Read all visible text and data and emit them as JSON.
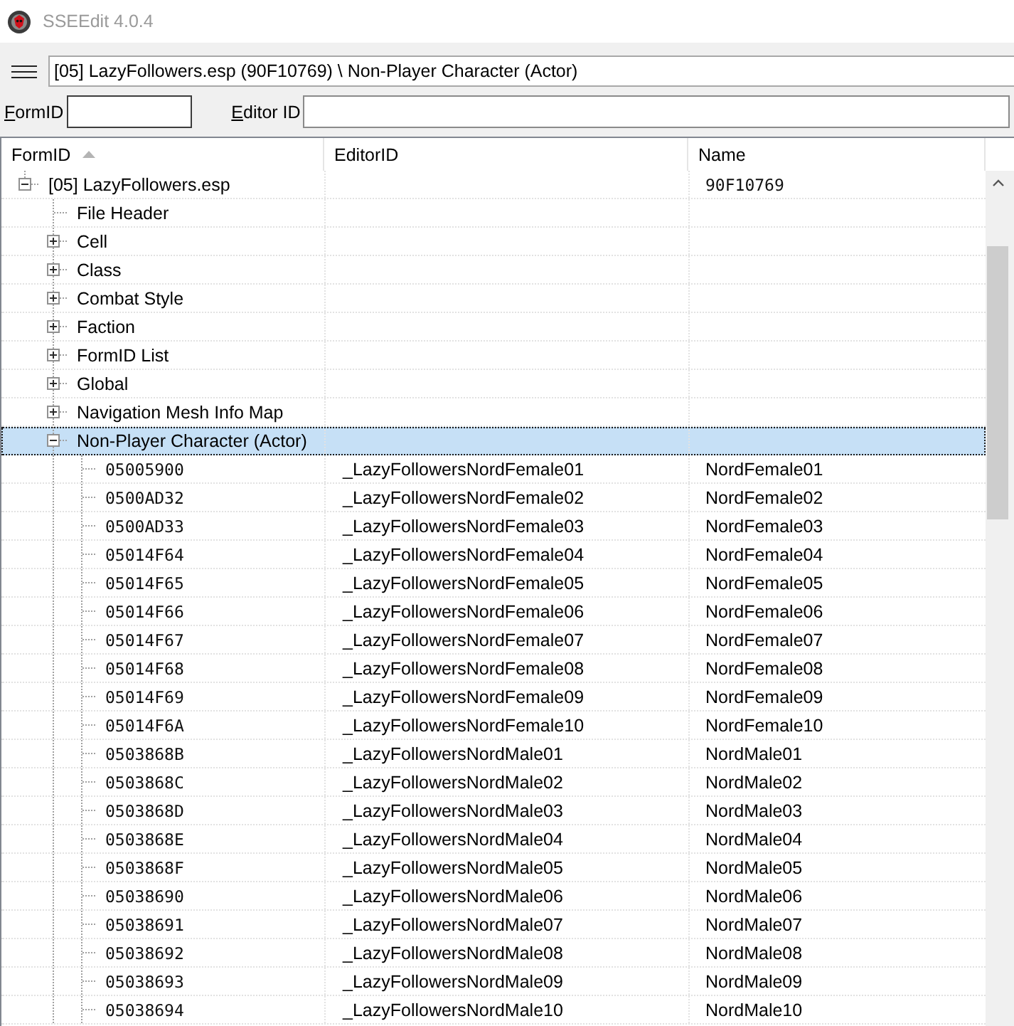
{
  "window": {
    "title": "SSEEdit 4.0.4"
  },
  "path_field": {
    "value": "[05] LazyFollowers.esp (90F10769) \\ Non-Player Character (Actor)"
  },
  "filters": {
    "form_id": {
      "label": "FormID"
    },
    "editor_id": {
      "label": "Editor ID"
    }
  },
  "tree": {
    "columns": [
      {
        "label": "FormID",
        "sorted_ascending": true
      },
      {
        "label": "EditorID",
        "sorted_ascending": false
      },
      {
        "label": "Name",
        "sorted_ascending": false
      }
    ],
    "nodes": [
      {
        "kind": "file",
        "label": "[05] LazyFollowers.esp",
        "name": "90F10769",
        "expanded": true,
        "selected": false,
        "children": [
          {
            "kind": "leaf",
            "label": "File Header",
            "selected": false
          },
          {
            "kind": "group",
            "label": "Cell",
            "expanded": false,
            "selected": false
          },
          {
            "kind": "group",
            "label": "Class",
            "expanded": false,
            "selected": false
          },
          {
            "kind": "group",
            "label": "Combat Style",
            "expanded": false,
            "selected": false
          },
          {
            "kind": "group",
            "label": "Faction",
            "expanded": false,
            "selected": false
          },
          {
            "kind": "group",
            "label": "FormID List",
            "expanded": false,
            "selected": false
          },
          {
            "kind": "group",
            "label": "Global",
            "expanded": false,
            "selected": false
          },
          {
            "kind": "group",
            "label": "Navigation Mesh Info Map",
            "expanded": false,
            "selected": false
          },
          {
            "kind": "group",
            "label": "Non-Player Character (Actor)",
            "expanded": true,
            "selected": true,
            "children": [
              {
                "kind": "record",
                "form_id": "05005900",
                "editor_id": "_LazyFollowersNordFemale01",
                "name": "NordFemale01",
                "selected": false
              },
              {
                "kind": "record",
                "form_id": "0500AD32",
                "editor_id": "_LazyFollowersNordFemale02",
                "name": "NordFemale02",
                "selected": false
              },
              {
                "kind": "record",
                "form_id": "0500AD33",
                "editor_id": "_LazyFollowersNordFemale03",
                "name": "NordFemale03",
                "selected": false
              },
              {
                "kind": "record",
                "form_id": "05014F64",
                "editor_id": "_LazyFollowersNordFemale04",
                "name": "NordFemale04",
                "selected": false
              },
              {
                "kind": "record",
                "form_id": "05014F65",
                "editor_id": "_LazyFollowersNordFemale05",
                "name": "NordFemale05",
                "selected": false
              },
              {
                "kind": "record",
                "form_id": "05014F66",
                "editor_id": "_LazyFollowersNordFemale06",
                "name": "NordFemale06",
                "selected": false
              },
              {
                "kind": "record",
                "form_id": "05014F67",
                "editor_id": "_LazyFollowersNordFemale07",
                "name": "NordFemale07",
                "selected": false
              },
              {
                "kind": "record",
                "form_id": "05014F68",
                "editor_id": "_LazyFollowersNordFemale08",
                "name": "NordFemale08",
                "selected": false
              },
              {
                "kind": "record",
                "form_id": "05014F69",
                "editor_id": "_LazyFollowersNordFemale09",
                "name": "NordFemale09",
                "selected": false
              },
              {
                "kind": "record",
                "form_id": "05014F6A",
                "editor_id": "_LazyFollowersNordFemale10",
                "name": "NordFemale10",
                "selected": false
              },
              {
                "kind": "record",
                "form_id": "0503868B",
                "editor_id": "_LazyFollowersNordMale01",
                "name": "NordMale01",
                "selected": false
              },
              {
                "kind": "record",
                "form_id": "0503868C",
                "editor_id": "_LazyFollowersNordMale02",
                "name": "NordMale02",
                "selected": false
              },
              {
                "kind": "record",
                "form_id": "0503868D",
                "editor_id": "_LazyFollowersNordMale03",
                "name": "NordMale03",
                "selected": false
              },
              {
                "kind": "record",
                "form_id": "0503868E",
                "editor_id": "_LazyFollowersNordMale04",
                "name": "NordMale04",
                "selected": false
              },
              {
                "kind": "record",
                "form_id": "0503868F",
                "editor_id": "_LazyFollowersNordMale05",
                "name": "NordMale05",
                "selected": false
              },
              {
                "kind": "record",
                "form_id": "05038690",
                "editor_id": "_LazyFollowersNordMale06",
                "name": "NordMale06",
                "selected": false
              },
              {
                "kind": "record",
                "form_id": "05038691",
                "editor_id": "_LazyFollowersNordMale07",
                "name": "NordMale07",
                "selected": false
              },
              {
                "kind": "record",
                "form_id": "05038692",
                "editor_id": "_LazyFollowersNordMale08",
                "name": "NordMale08",
                "selected": false
              },
              {
                "kind": "record",
                "form_id": "05038693",
                "editor_id": "_LazyFollowersNordMale09",
                "name": "NordMale09",
                "selected": false
              },
              {
                "kind": "record",
                "form_id": "05038694",
                "editor_id": "_LazyFollowersNordMale10",
                "name": "NordMale10",
                "selected": false
              }
            ]
          }
        ]
      }
    ]
  }
}
